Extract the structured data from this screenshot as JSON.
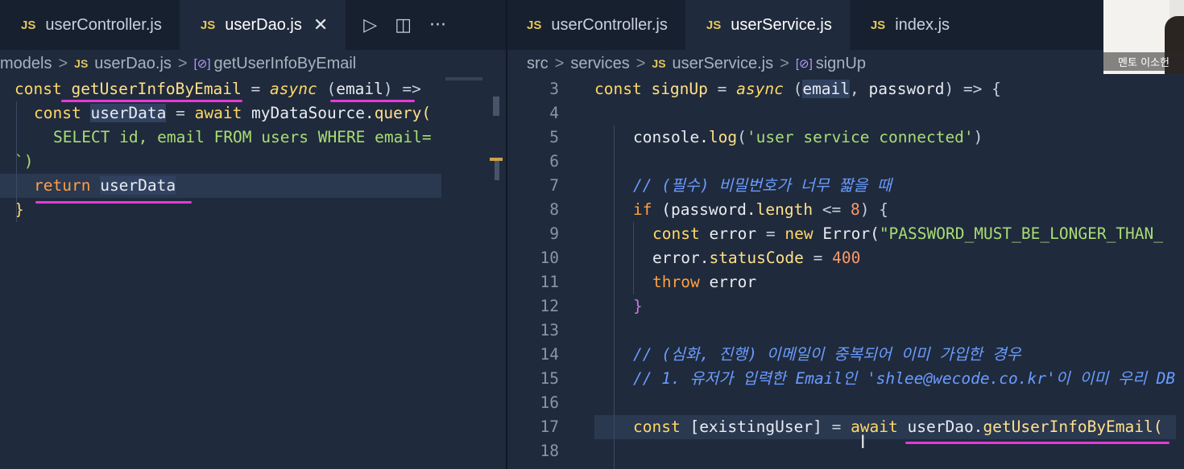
{
  "left_tabs": [
    {
      "lang": "JS",
      "name": "userController.js",
      "active": false
    },
    {
      "lang": "JS",
      "name": "userDao.js",
      "active": true
    }
  ],
  "left_breadcrumb": {
    "folder": "models",
    "lang": "JS",
    "file": "userDao.js",
    "symbol": "getUserInfoByEmail"
  },
  "right_tabs": [
    {
      "lang": "JS",
      "name": "userController.js",
      "active": false
    },
    {
      "lang": "JS",
      "name": "userService.js",
      "active": true
    },
    {
      "lang": "JS",
      "name": "index.js",
      "active": false
    }
  ],
  "right_breadcrumb": {
    "root": "src",
    "folder": "services",
    "lang": "JS",
    "file": "userService.js",
    "symbol": "signUp"
  },
  "webcam": {
    "name": "멘토 이소헌"
  },
  "left_code": {
    "l1": {
      "a": "const ",
      "b": "getUserInfoByEmail",
      "c": " = ",
      "d": "async",
      "e": " (",
      "f": "email",
      "g": ") =>"
    },
    "l2": {
      "a": "const ",
      "b": "userData",
      "c": " = ",
      "d": "await",
      "e": " myDataSource.",
      "f": "query("
    },
    "l3": {
      "a": "SELECT id, email FROM users WHERE email="
    },
    "l4": {
      "a": "`)"
    },
    "l5": {
      "a": "return",
      "b": "userData"
    },
    "l6": {
      "a": "}"
    }
  },
  "right_code": {
    "n3": "3",
    "n4": "4",
    "n5": "5",
    "n6": "6",
    "n7": "7",
    "n8": "8",
    "n9": "9",
    "n10": "10",
    "n11": "11",
    "n12": "12",
    "n13": "13",
    "n14": "14",
    "n15": "15",
    "n16": "16",
    "n17": "17",
    "n18": "18",
    "l3": {
      "a": "const ",
      "b": "signUp",
      "c": " = ",
      "d": "async",
      "e": " (",
      "f": "email",
      "g": ", ",
      "h": "password",
      "i": ") => {"
    },
    "l5": {
      "a": "console.",
      "b": "log",
      "c": "(",
      "d": "'user service connected'",
      "e": ")"
    },
    "l7": {
      "a": "// (필수) 비밀번호가 너무 짧을 때"
    },
    "l8": {
      "a": "if",
      "b": " (password.",
      "c": "length",
      "d": " <= ",
      "e": "8",
      "f": ") {"
    },
    "l9": {
      "a": "const ",
      "b": "error",
      "c": " = ",
      "d": "new",
      "e": " Error(",
      "f": "\"PASSWORD_MUST_BE_LONGER_THAN_"
    },
    "l10": {
      "a": "error.",
      "b": "statusCode",
      "c": " = ",
      "d": "400"
    },
    "l11": {
      "a": "throw",
      "b": " error"
    },
    "l12": {
      "a": "}"
    },
    "l14": {
      "a": "// (심화, 진행) 이메일이 중복되어 이미 가입한 경우"
    },
    "l15": {
      "a": "// 1. 유저가 입력한 Email인 'shlee@wecode.co.kr'이 이미 우리 DB"
    },
    "l17": {
      "a": "const ",
      "b": "[existingUser]",
      "c": " = ",
      "d": "await",
      "e": " userDao.",
      "f": "getUserInfoByEmail("
    }
  }
}
